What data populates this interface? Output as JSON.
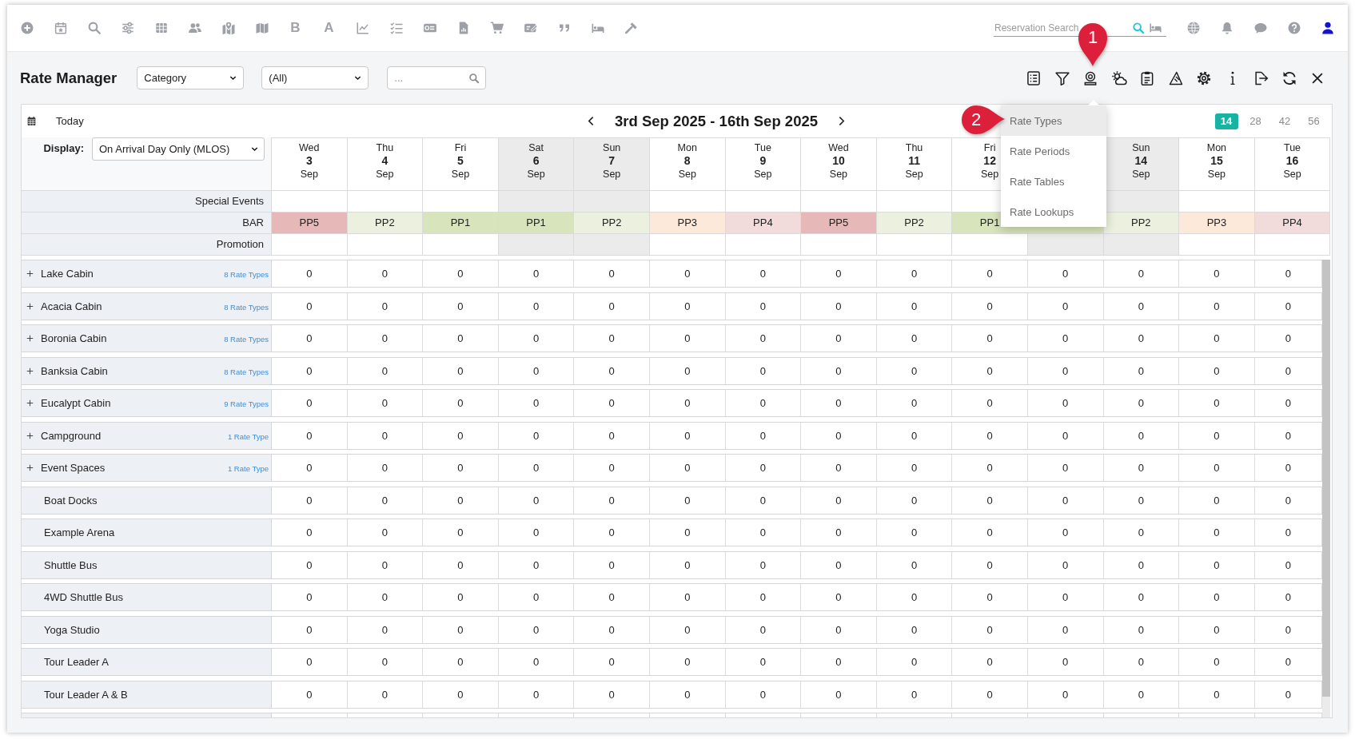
{
  "top_bar": {
    "letter_tools": [
      "B",
      "A"
    ],
    "reservation_search": {
      "placeholder": "Reservation Search"
    }
  },
  "rate_manager": {
    "title": "Rate Manager",
    "filters": [
      {
        "value": "Category"
      },
      {
        "value": "(All)"
      }
    ],
    "search": {
      "placeholder": "..."
    }
  },
  "calendar": {
    "today": "Today",
    "range": "3rd Sep 2025 - 16th Sep 2025",
    "spans": [
      {
        "label": "14",
        "selected": true
      },
      {
        "label": "28",
        "selected": false
      },
      {
        "label": "42",
        "selected": false
      },
      {
        "label": "56",
        "selected": false
      }
    ],
    "display": {
      "label": "Display:",
      "value": "On Arrival Day Only (MLOS)"
    },
    "days": [
      {
        "weekday": "Wed",
        "date": "3",
        "month": "Sep",
        "shaded": false
      },
      {
        "weekday": "Thu",
        "date": "4",
        "month": "Sep",
        "shaded": false
      },
      {
        "weekday": "Fri",
        "date": "5",
        "month": "Sep",
        "shaded": false
      },
      {
        "weekday": "Sat",
        "date": "6",
        "month": "Sep",
        "shaded": true
      },
      {
        "weekday": "Sun",
        "date": "7",
        "month": "Sep",
        "shaded": true
      },
      {
        "weekday": "Mon",
        "date": "8",
        "month": "Sep",
        "shaded": false
      },
      {
        "weekday": "Tue",
        "date": "9",
        "month": "Sep",
        "shaded": false
      },
      {
        "weekday": "Wed",
        "date": "10",
        "month": "Sep",
        "shaded": false
      },
      {
        "weekday": "Thu",
        "date": "11",
        "month": "Sep",
        "shaded": false
      },
      {
        "weekday": "Fri",
        "date": "12",
        "month": "Sep",
        "shaded": false
      },
      {
        "shaded": true
      },
      {
        "weekday": "Sun",
        "date": "14",
        "month": "Sep",
        "shaded": true
      },
      {
        "weekday": "Mon",
        "date": "15",
        "month": "Sep",
        "shaded": false
      },
      {
        "weekday": "Tue",
        "date": "16",
        "month": "Sep",
        "shaded": false
      }
    ],
    "rate_rows": [
      {
        "label": "Special Events"
      },
      {
        "label": "BAR",
        "cells": [
          {
            "text": "PP5",
            "color": "#e6b8b7"
          },
          {
            "text": "PP2",
            "color": "#ebf1de"
          },
          {
            "text": "PP1",
            "color": "#d8e4bc"
          },
          {
            "text": "PP1",
            "color": "#d8e4bc"
          },
          {
            "text": "PP2",
            "color": "#ebf1de"
          },
          {
            "text": "PP3",
            "color": "#fde9d9"
          },
          {
            "text": "PP4",
            "color": "#f2dcdb"
          },
          {
            "text": "PP5",
            "color": "#e6b8b7"
          },
          {
            "text": "PP2",
            "color": "#ebf1de"
          },
          {
            "text": "PP1",
            "color": "#d8e4bc"
          },
          {
            "color": "#d8e4bc"
          },
          {
            "text": "PP2",
            "color": "#ebf1de"
          },
          {
            "text": "PP3",
            "color": "#fde9d9"
          },
          {
            "text": "PP4",
            "color": "#f2dcdb"
          }
        ]
      },
      {
        "label": "Promotion"
      }
    ]
  },
  "rows": [
    {
      "kind": "category",
      "name": "Lake Cabin",
      "rate_types": "8 Rate Types",
      "expanded": false,
      "values": [
        "0",
        "0",
        "0",
        "0",
        "0",
        "0",
        "0",
        "0",
        "0",
        "0",
        "0",
        "0",
        "0",
        "0"
      ]
    },
    {
      "kind": "category",
      "name": "Acacia Cabin",
      "rate_types": "8 Rate Types",
      "expanded": false,
      "values": [
        "0",
        "0",
        "0",
        "0",
        "0",
        "0",
        "0",
        "0",
        "0",
        "0",
        "0",
        "0",
        "0",
        "0"
      ]
    },
    {
      "kind": "category",
      "name": "Boronia Cabin",
      "rate_types": "8 Rate Types",
      "expanded": false,
      "values": [
        "0",
        "0",
        "0",
        "0",
        "0",
        "0",
        "0",
        "0",
        "0",
        "0",
        "0",
        "0",
        "0",
        "0"
      ]
    },
    {
      "kind": "category",
      "name": "Banksia Cabin",
      "rate_types": "8 Rate Types",
      "expanded": false,
      "values": [
        "0",
        "0",
        "0",
        "0",
        "0",
        "0",
        "0",
        "0",
        "0",
        "0",
        "0",
        "0",
        "0",
        "0"
      ]
    },
    {
      "kind": "category",
      "name": "Eucalypt Cabin",
      "rate_types": "9 Rate Types",
      "expanded": false,
      "values": [
        "0",
        "0",
        "0",
        "0",
        "0",
        "0",
        "0",
        "0",
        "0",
        "0",
        "0",
        "0",
        "0",
        "0"
      ]
    },
    {
      "kind": "category",
      "name": "Campground",
      "rate_types": "1 Rate Type",
      "expanded": false,
      "values": [
        "0",
        "0",
        "0",
        "0",
        "0",
        "0",
        "0",
        "0",
        "0",
        "0",
        "0",
        "0",
        "0",
        "0"
      ]
    },
    {
      "kind": "category",
      "name": "Event Spaces",
      "rate_types": "1 Rate Type",
      "expanded": false,
      "values": [
        "0",
        "0",
        "0",
        "0",
        "0",
        "0",
        "0",
        "0",
        "0",
        "0",
        "0",
        "0",
        "0",
        "0"
      ]
    },
    {
      "kind": "area",
      "name": "Boat Docks",
      "values": [
        "0",
        "0",
        "0",
        "0",
        "0",
        "0",
        "0",
        "0",
        "0",
        "0",
        "0",
        "0",
        "0",
        "0"
      ]
    },
    {
      "kind": "area",
      "name": "Example Arena",
      "values": [
        "0",
        "0",
        "0",
        "0",
        "0",
        "0",
        "0",
        "0",
        "0",
        "0",
        "0",
        "0",
        "0",
        "0"
      ]
    },
    {
      "kind": "area",
      "name": "Shuttle Bus",
      "values": [
        "0",
        "0",
        "0",
        "0",
        "0",
        "0",
        "0",
        "0",
        "0",
        "0",
        "0",
        "0",
        "0",
        "0"
      ]
    },
    {
      "kind": "area",
      "name": "4WD Shuttle Bus",
      "values": [
        "0",
        "0",
        "0",
        "0",
        "0",
        "0",
        "0",
        "0",
        "0",
        "0",
        "0",
        "0",
        "0",
        "0"
      ]
    },
    {
      "kind": "area",
      "name": "Yoga Studio",
      "values": [
        "0",
        "0",
        "0",
        "0",
        "0",
        "0",
        "0",
        "0",
        "0",
        "0",
        "0",
        "0",
        "0",
        "0"
      ]
    },
    {
      "kind": "area",
      "name": "Tour Leader A",
      "values": [
        "0",
        "0",
        "0",
        "0",
        "0",
        "0",
        "0",
        "0",
        "0",
        "0",
        "0",
        "0",
        "0",
        "0"
      ]
    },
    {
      "kind": "area",
      "name": "Tour Leader A & B",
      "values": [
        "0",
        "0",
        "0",
        "0",
        "0",
        "0",
        "0",
        "0",
        "0",
        "0",
        "0",
        "0",
        "0",
        "0"
      ]
    }
  ],
  "menu": {
    "items": [
      {
        "label": "Rate Types",
        "highlighted": true
      },
      {
        "label": "Rate Periods",
        "highlighted": false
      },
      {
        "label": "Rate Tables",
        "highlighted": false
      },
      {
        "label": "Rate Lookups",
        "highlighted": false
      }
    ]
  },
  "callouts": [
    {
      "number": "1"
    },
    {
      "number": "2"
    }
  ]
}
